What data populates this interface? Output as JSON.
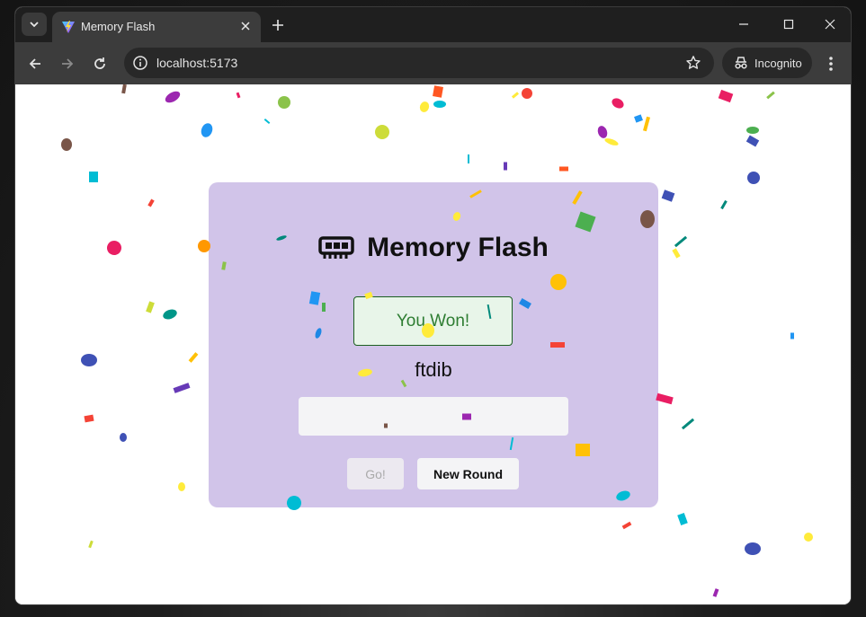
{
  "browser": {
    "tab_title": "Memory Flash",
    "url": "localhost:5173",
    "incognito_label": "Incognito"
  },
  "app": {
    "title": "Memory Flash",
    "status": "You Won!",
    "word": "ftdib",
    "answer_value": "",
    "go_label": "Go!",
    "new_round_label": "New Round",
    "colors": {
      "card": "#d1c4e9",
      "status_bg": "#e8f5e9",
      "status_text": "#2e7d32"
    }
  },
  "icons": [
    "chevron-down-icon",
    "vite-logo-icon",
    "close-icon",
    "plus-icon",
    "minimize-icon",
    "maximize-icon",
    "back-icon",
    "forward-icon",
    "reload-icon",
    "info-icon",
    "star-icon",
    "incognito-icon",
    "kebab-menu-icon",
    "memory-chip-icon"
  ]
}
